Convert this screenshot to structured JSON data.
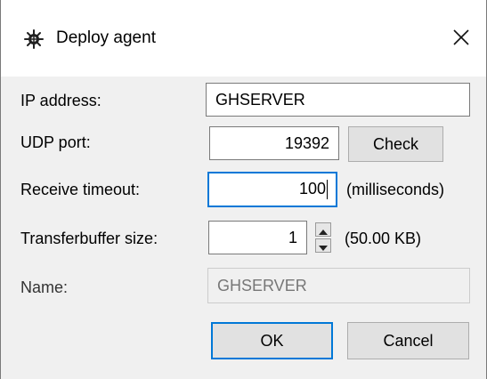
{
  "window": {
    "title": "Deploy agent",
    "app_icon": "gear-icon",
    "close_icon": "close-icon"
  },
  "form": {
    "ip_address": {
      "label": "IP address:",
      "value": "GHSERVER"
    },
    "udp_port": {
      "label": "UDP port:",
      "value": "19392",
      "check_label": "Check"
    },
    "receive_timeout": {
      "label": "Receive timeout:",
      "value": "100",
      "unit": "(milliseconds)"
    },
    "transferbuffer_size": {
      "label": "Transferbuffer size:",
      "value": "1",
      "unit": "(50.00 KB)",
      "up_icon": "spin-up-icon",
      "down_icon": "spin-down-icon"
    },
    "name": {
      "label": "Name:",
      "value": "GHSERVER",
      "enabled": false
    }
  },
  "buttons": {
    "ok_label": "OK",
    "cancel_label": "Cancel"
  },
  "colors": {
    "accent": "#0078d7",
    "background": "#f0f0f0",
    "titlebar": "#ffffff"
  }
}
